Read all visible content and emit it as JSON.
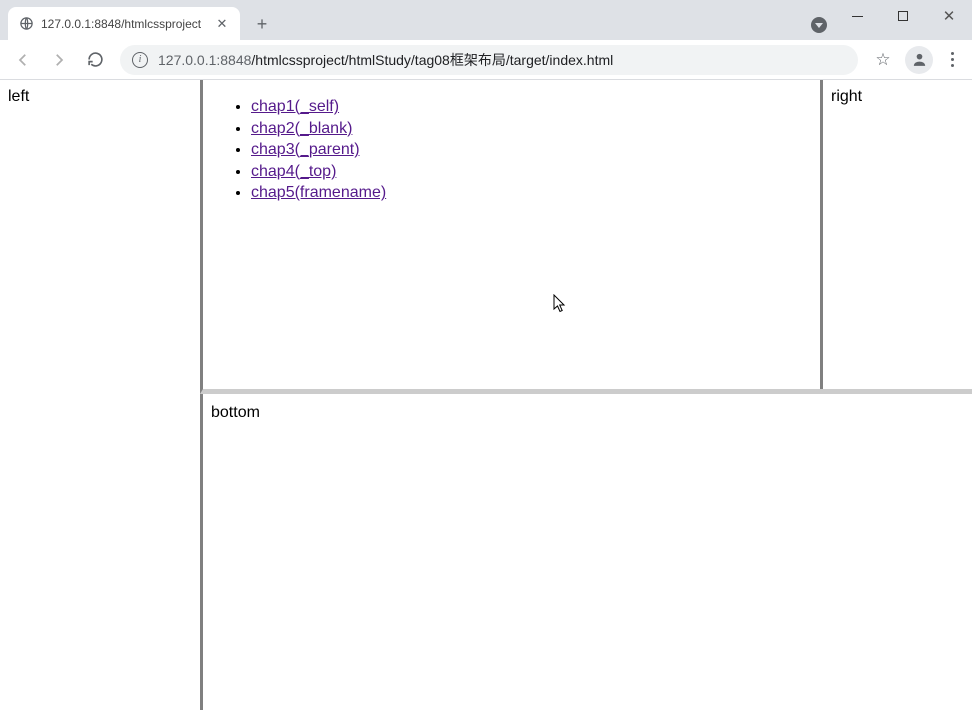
{
  "tab": {
    "title": "127.0.0.1:8848/htmlcssproject"
  },
  "address": {
    "host": "127.0.0.1:8848",
    "path": "/htmlcssproject/htmlStudy/tag08框架布局/target/index.html"
  },
  "frames": {
    "left_text": "left",
    "right_text": "right",
    "bottom_text": "bottom",
    "center_links": [
      "chap1(_self)",
      "chap2(_blank)",
      "chap3(_parent)",
      "chap4(_top)",
      "chap5(framename)"
    ]
  }
}
